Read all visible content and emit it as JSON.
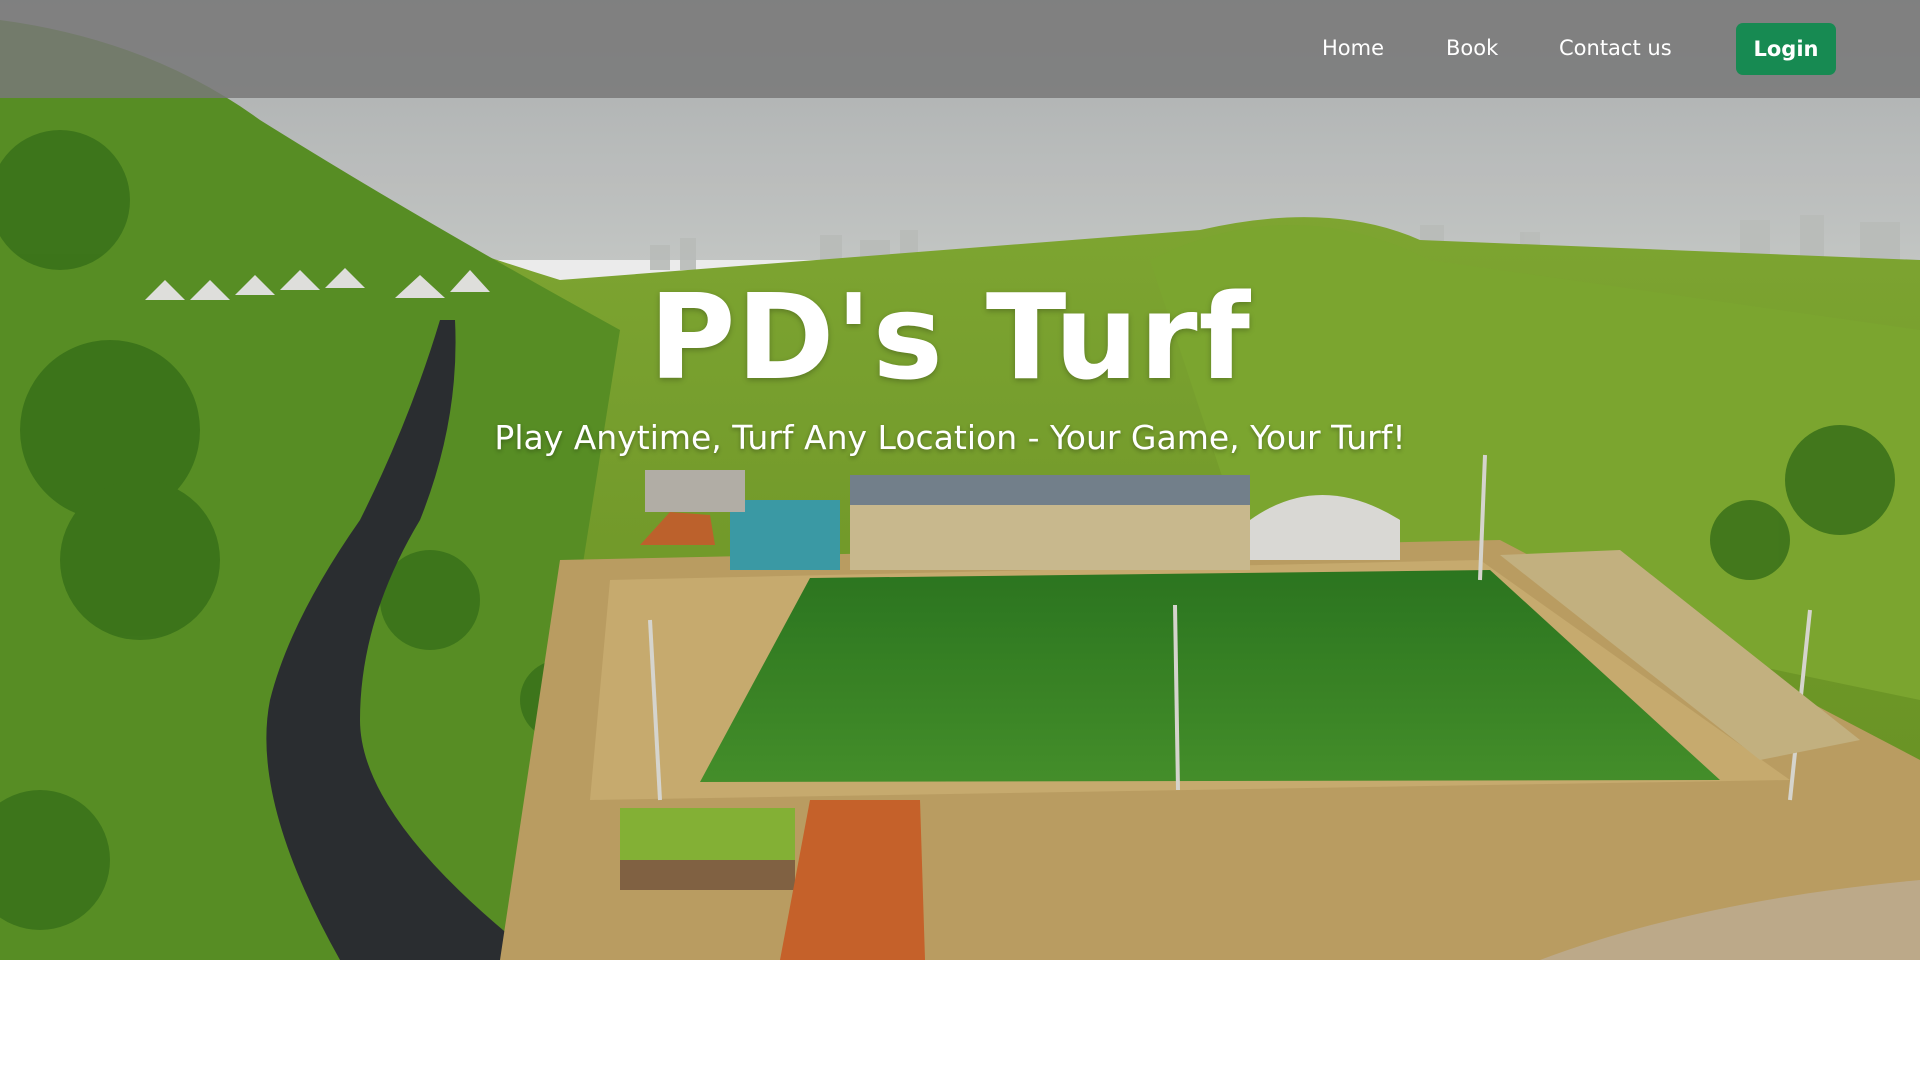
{
  "nav": {
    "links": [
      "Home",
      "Book",
      "Contact us"
    ],
    "login_label": "Login"
  },
  "hero": {
    "title": "PD's Turf",
    "subtitle": "Play Anytime, Turf Any Location - Your Game, Your Turf!"
  },
  "colors": {
    "login_button": "#178a52",
    "navbar": "#787878",
    "pitch": "#3d8f2a",
    "hillside": "#7cae2c"
  }
}
